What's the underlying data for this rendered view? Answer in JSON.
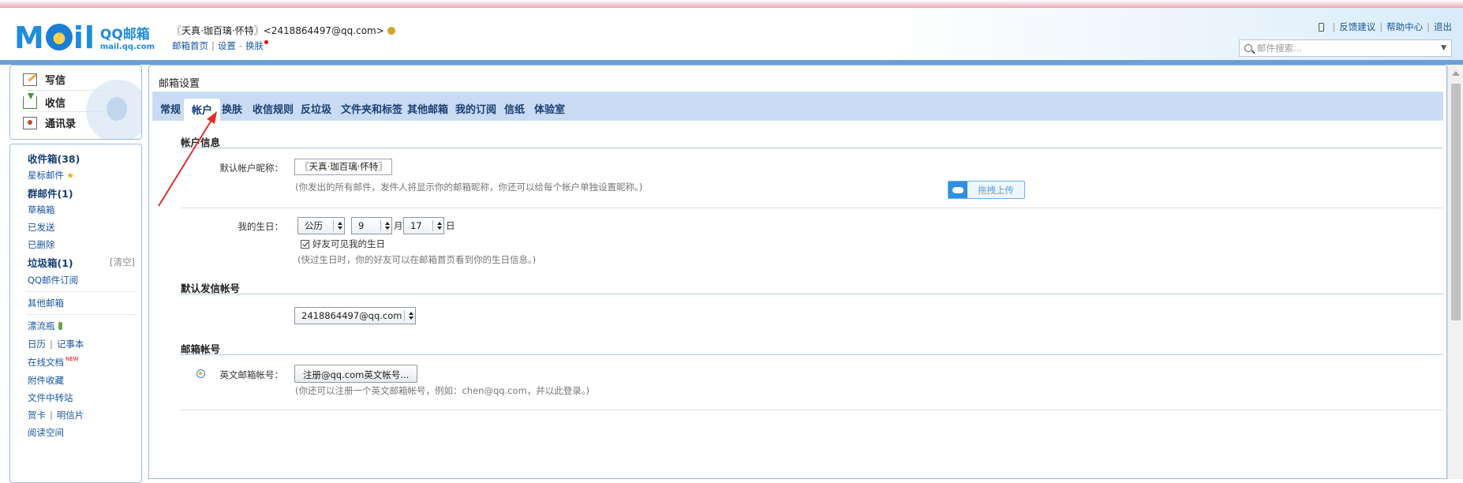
{
  "header": {
    "logo_big": "Mail",
    "logo_line1": "QQ邮箱",
    "logo_line2": "mail.qq.com",
    "user_name": "〖天真·珈百璃·怀特〗",
    "user_email": "<2418864497@qq.com>",
    "link_home": "邮箱首页",
    "link_settings": "设置",
    "link_skin": "换肤",
    "sep": "|",
    "top_feedback": "反馈建议",
    "top_help": "帮助中心",
    "top_logout": "退出",
    "search_placeholder": "邮件搜索..."
  },
  "nav_actions": {
    "write": "写信",
    "inbox": "收信",
    "contacts": "通讯录"
  },
  "folders": {
    "inbox": "收件箱(38)",
    "starred": "星标邮件",
    "group": "群邮件(1)",
    "drafts": "草稿箱",
    "sent": "已发送",
    "deleted": "已删除",
    "spam": "垃圾箱(1)",
    "spam_clear": "[清空]",
    "subscribe": "QQ邮件订阅",
    "other": "其他邮箱",
    "bottle": "漂流瓶",
    "calendar": "日历",
    "notes": "记事本",
    "docs": "在线文档",
    "docs_new": "NEW",
    "attach": "附件收藏",
    "transfer": "文件中转站",
    "card": "贺卡",
    "postcard": "明信片",
    "reading": "阅读空间",
    "sep": "|"
  },
  "main": {
    "title": "邮箱设置",
    "tabs": [
      "常规",
      "帐户",
      "换肤",
      "收信规则",
      "反垃圾",
      "文件夹和标签",
      "其他邮箱",
      "我的订阅",
      "信纸",
      "体验室"
    ],
    "active_tab": "帐户",
    "account_info": {
      "section": "帐户信息",
      "nickname_label": "默认帐户昵称：",
      "nickname_value": "〖天真·珈百璃·怀特〗",
      "nickname_hint": "(你发出的所有邮件，发件人将显示你的邮箱昵称，你还可以给每个帐户单独设置昵称。)",
      "upload_label": "拖拽上传",
      "birthday_label": "我的生日：",
      "calendar_type": "公历",
      "month": "9",
      "month_unit": "月",
      "day": "17",
      "day_unit": "日",
      "birthday_check": "好友可见我的生日",
      "birthday_hint": "(快过生日时，你的好友可以在邮箱首页看到你的生日信息。)"
    },
    "default_sender": {
      "section": "默认发信帐号",
      "value": "2418864497@qq.com"
    },
    "mail_account": {
      "section": "邮箱帐号",
      "english_label": "英文邮箱帐号：",
      "register_button": "注册@qq.com英文帐号...",
      "english_hint": "(你还可以注册一个英文邮箱帐号，例如：chen@qq.com，并以此登录。)"
    }
  },
  "colors": {
    "accent": "#1f8cdc",
    "tabbar": "#c9dcf3",
    "link": "#1a56a0",
    "annotation": "#e0302a"
  }
}
